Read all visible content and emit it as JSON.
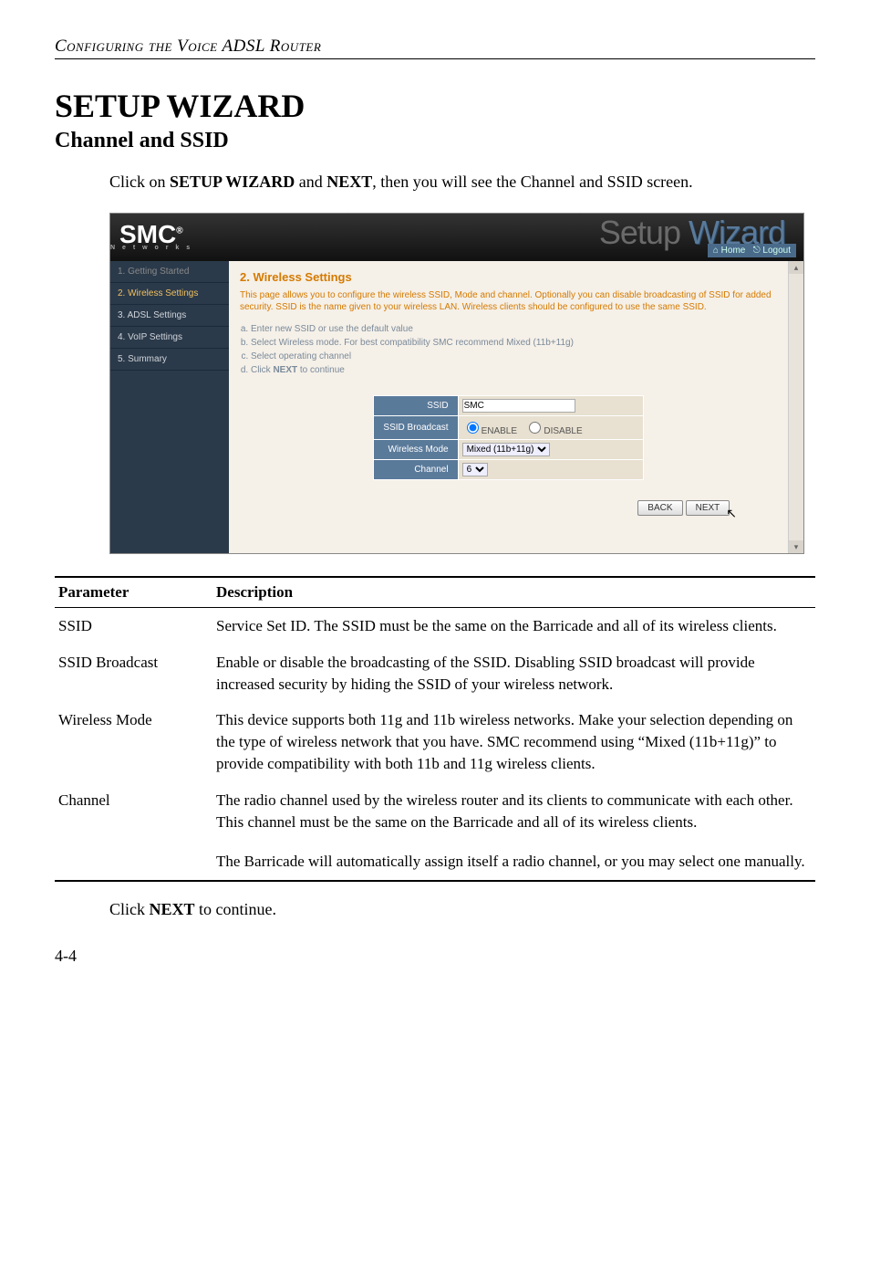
{
  "page_header": "Configuring the Voice ADSL Router",
  "h1": "SETUP WIZARD",
  "h2": "Channel and SSID",
  "intro_parts": {
    "a": "Click on ",
    "b": "SETUP WIZARD",
    "c": " and ",
    "d": "NEXT",
    "e": ", then you will see the Channel and SSID screen."
  },
  "router": {
    "logo": "SMC",
    "logo_reg": "®",
    "logo_sub": "N e t w o r k s",
    "title_a": "Setup ",
    "title_b": "Wizard",
    "home_link": "Home",
    "logout_link": "Logout",
    "nav": {
      "n1": "1. Getting Started",
      "n2": "2. Wireless Settings",
      "n3": "3. ADSL Settings",
      "n4": "4. VoIP Settings",
      "n5": "5. Summary"
    },
    "step_title": "2. Wireless Settings",
    "step_desc": "This page allows you to configure the wireless SSID, Mode and channel. Optionally you can disable broadcasting of SSID for added security. SSID is the name given to your wireless LAN. Wireless clients should be configured to use the same SSID.",
    "bullets": {
      "a": "Enter new SSID or use the default value",
      "b": "Select Wireless mode. For best compatibility SMC recommend Mixed (11b+11g)",
      "c": "Select operating channel",
      "d_prefix": "Click ",
      "d_bold": "NEXT",
      "d_suffix": " to continue"
    },
    "form": {
      "ssid_label": "SSID",
      "ssid_value": "SMC",
      "broadcast_label": "SSID Broadcast",
      "enable": "ENABLE",
      "disable": "DISABLE",
      "mode_label": "Wireless Mode",
      "mode_value": "Mixed (11b+11g)",
      "channel_label": "Channel",
      "channel_value": "6"
    },
    "buttons": {
      "back": "BACK",
      "next": "NEXT"
    }
  },
  "param_header": {
    "c1": "Parameter",
    "c2": "Description"
  },
  "params": {
    "r1": {
      "name": "SSID",
      "desc": "Service Set ID. The SSID must be the same on the Barricade and all of its wireless clients."
    },
    "r2": {
      "name": "SSID Broadcast",
      "desc": "Enable or disable the broadcasting of the SSID. Disabling SSID broadcast will provide increased security by hiding the SSID of your wireless network."
    },
    "r3": {
      "name": "Wireless Mode",
      "desc": "This device supports both 11g and 11b wireless networks. Make your selection depending on the type of wireless network that you have. SMC recommend using “Mixed (11b+11g)” to provide compatibility with both 11b and 11g wireless clients."
    },
    "r4": {
      "name": "Channel",
      "desc": "The radio channel used by the wireless router and its clients to communicate with each other. This channel must be the same on the Barricade and all of its wireless clients."
    },
    "r5": {
      "name": "",
      "desc": "The Barricade will automatically assign itself a radio channel, or you may select one manually."
    }
  },
  "closing": {
    "a": "Click ",
    "b": "NEXT",
    "c": " to continue."
  },
  "pagenum": "4-4"
}
